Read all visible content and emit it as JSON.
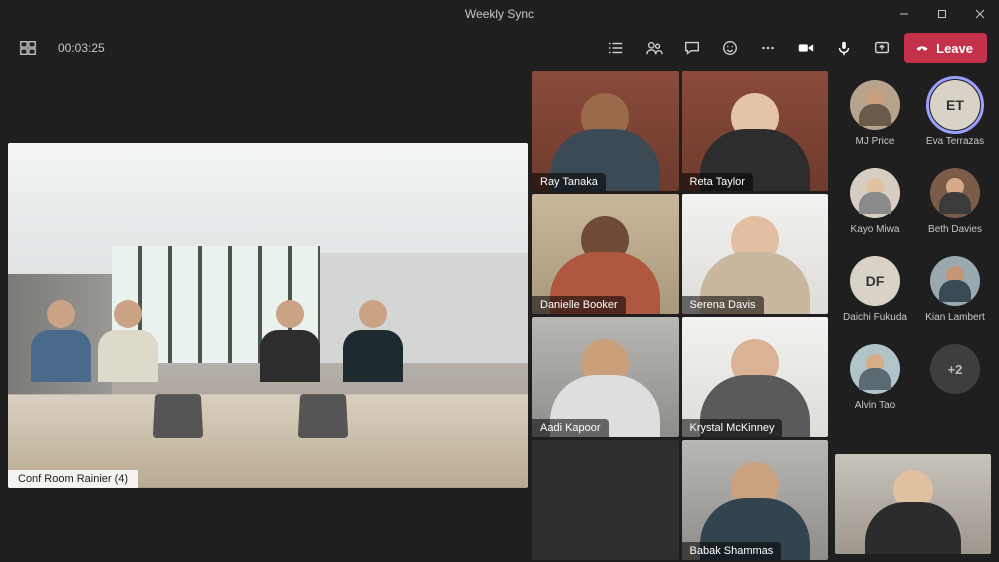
{
  "window": {
    "title": "Weekly Sync"
  },
  "toolbar": {
    "call_duration": "00:03:25",
    "leave_label": "Leave"
  },
  "main_room": {
    "label": "Conf Room Rainier (4)"
  },
  "tiles": [
    {
      "name": "Ray Tanaka"
    },
    {
      "name": "Reta Taylor"
    },
    {
      "name": "Danielle Booker"
    },
    {
      "name": "Serena Davis"
    },
    {
      "name": "Aadi Kapoor"
    },
    {
      "name": "Krystal McKinney"
    },
    {
      "name": "Babak Shammas"
    }
  ],
  "side_participants": [
    {
      "name": "MJ Price",
      "type": "photo"
    },
    {
      "name": "Eva Terrazas",
      "type": "initials",
      "initials": "ET",
      "speaking": true
    },
    {
      "name": "Kayo Miwa",
      "type": "photo"
    },
    {
      "name": "Beth Davies",
      "type": "photo"
    },
    {
      "name": "Daichi Fukuda",
      "type": "initials",
      "initials": "DF"
    },
    {
      "name": "Kian Lambert",
      "type": "photo"
    },
    {
      "name": "Alvin Tao",
      "type": "photo"
    },
    {
      "name": "+2",
      "type": "more"
    }
  ],
  "colors": {
    "leave_bg": "#c4314b",
    "speaking_ring": "#9aa0ff"
  }
}
